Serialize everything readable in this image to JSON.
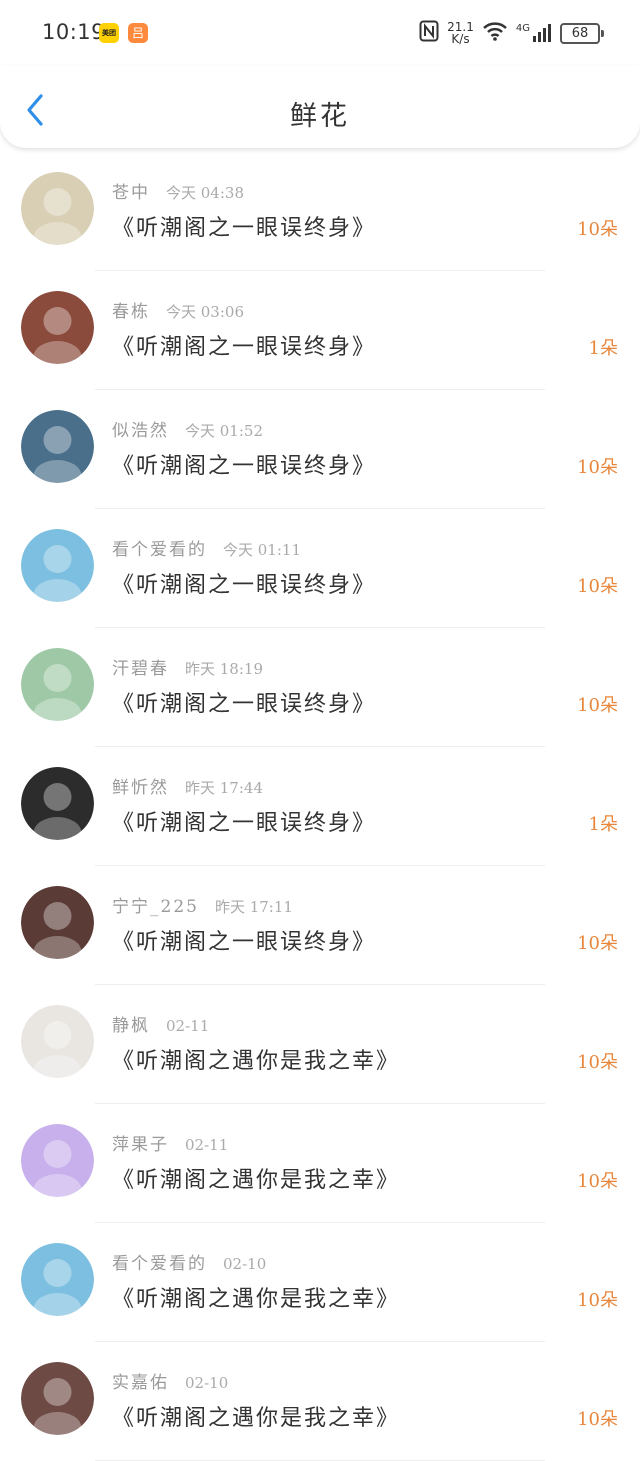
{
  "status_bar": {
    "time": "10:19",
    "app_icon_1": "美团",
    "app_icon_2": "吕",
    "net_speed_value": "21.1",
    "net_speed_unit": "K/s",
    "network": "4G",
    "battery": "68"
  },
  "header": {
    "title": "鲜花"
  },
  "items": [
    {
      "name": "苍中",
      "time": "今天 04:38",
      "book": "《听潮阁之一眼误终身》",
      "count": "10朵",
      "avatar_color": "#d9cfb4"
    },
    {
      "name": "春栋",
      "time": "今天 03:06",
      "book": "《听潮阁之一眼误终身》",
      "count": "1朵",
      "avatar_color": "#8b4b3c"
    },
    {
      "name": "似浩然",
      "time": "今天 01:52",
      "book": "《听潮阁之一眼误终身》",
      "count": "10朵",
      "avatar_color": "#4a6f8a"
    },
    {
      "name": "看个爱看的",
      "time": "今天 01:11",
      "book": "《听潮阁之一眼误终身》",
      "count": "10朵",
      "avatar_color": "#7cbfe0"
    },
    {
      "name": "汗碧春",
      "time": "昨天 18:19",
      "book": "《听潮阁之一眼误终身》",
      "count": "10朵",
      "avatar_color": "#9fc9a6"
    },
    {
      "name": "鲜忻然",
      "time": "昨天 17:44",
      "book": "《听潮阁之一眼误终身》",
      "count": "1朵",
      "avatar_color": "#2c2c2c"
    },
    {
      "name": "宁宁_225",
      "time": "昨天 17:11",
      "book": "《听潮阁之一眼误终身》",
      "count": "10朵",
      "avatar_color": "#5a3b36"
    },
    {
      "name": "静枫",
      "time": "02-11",
      "book": "《听潮阁之遇你是我之幸》",
      "count": "10朵",
      "avatar_color": "#e9e6e2"
    },
    {
      "name": "萍果子",
      "time": "02-11",
      "book": "《听潮阁之遇你是我之幸》",
      "count": "10朵",
      "avatar_color": "#c8b0ec"
    },
    {
      "name": "看个爱看的",
      "time": "02-10",
      "book": "《听潮阁之遇你是我之幸》",
      "count": "10朵",
      "avatar_color": "#7cbfe0"
    },
    {
      "name": "实嘉佑",
      "time": "02-10",
      "book": "《听潮阁之遇你是我之幸》",
      "count": "10朵",
      "avatar_color": "#6e4a44"
    }
  ]
}
